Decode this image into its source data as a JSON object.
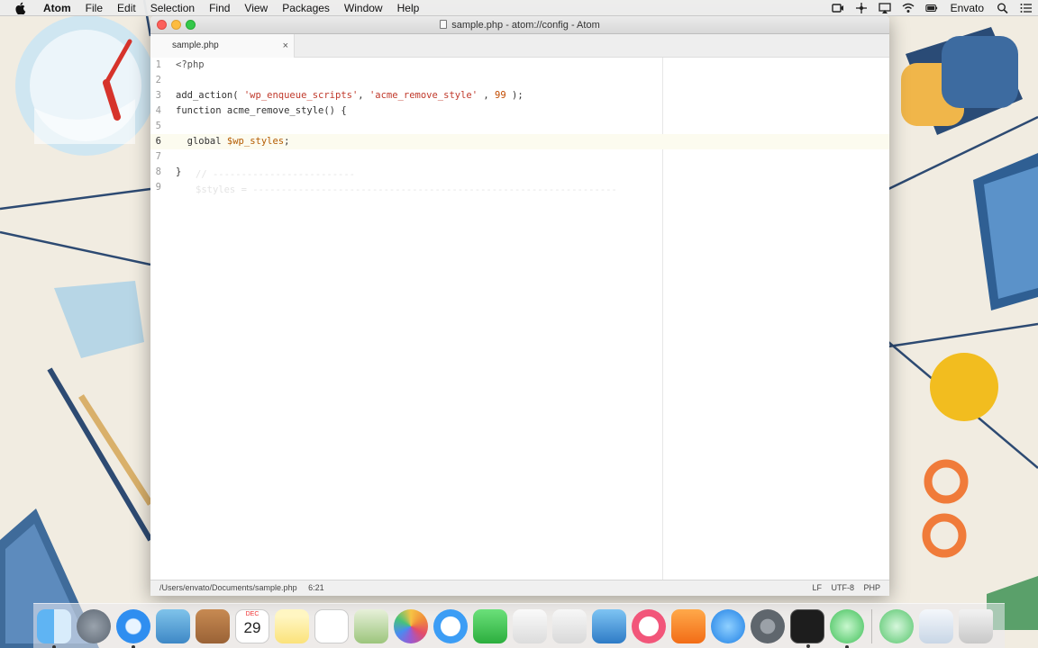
{
  "menubar": {
    "app_name": "Atom",
    "items": [
      "File",
      "Edit",
      "Selection",
      "Find",
      "View",
      "Packages",
      "Window",
      "Help"
    ],
    "user": "Envato"
  },
  "window": {
    "title": "sample.php - atom://config - Atom",
    "tab": {
      "label": "sample.php",
      "close_glyph": "×"
    }
  },
  "editor": {
    "active_line": 6,
    "lines": [
      {
        "num": "1",
        "tokens": [
          {
            "t": "ph",
            "v": "<?php"
          }
        ]
      },
      {
        "num": "2",
        "tokens": []
      },
      {
        "num": "3",
        "tokens": [
          {
            "t": "plain",
            "v": "add_action( "
          },
          {
            "t": "str",
            "v": "'wp_enqueue_scripts'"
          },
          {
            "t": "plain",
            "v": ", "
          },
          {
            "t": "str",
            "v": "'acme_remove_style'"
          },
          {
            "t": "plain",
            "v": " , "
          },
          {
            "t": "num",
            "v": "99"
          },
          {
            "t": "plain",
            "v": " );"
          }
        ]
      },
      {
        "num": "4",
        "tokens": [
          {
            "t": "plain",
            "v": "function acme_remove_style() {"
          }
        ]
      },
      {
        "num": "5",
        "tokens": []
      },
      {
        "num": "6",
        "tokens": [
          {
            "t": "plain",
            "v": "  global "
          },
          {
            "t": "var",
            "v": "$wp_styles"
          },
          {
            "t": "plain",
            "v": ";"
          }
        ]
      },
      {
        "num": "7",
        "tokens": []
      },
      {
        "num": "8",
        "tokens": [
          {
            "t": "plain",
            "v": "}"
          }
        ]
      },
      {
        "num": "9",
        "tokens": []
      }
    ]
  },
  "statusbar": {
    "path": "/Users/envato/Documents/sample.php",
    "cursor": "6:21",
    "line_ending": "LF",
    "encoding": "UTF-8",
    "grammar": "PHP"
  },
  "dock": {
    "calendar": {
      "month": "DEC",
      "day": "29"
    }
  }
}
